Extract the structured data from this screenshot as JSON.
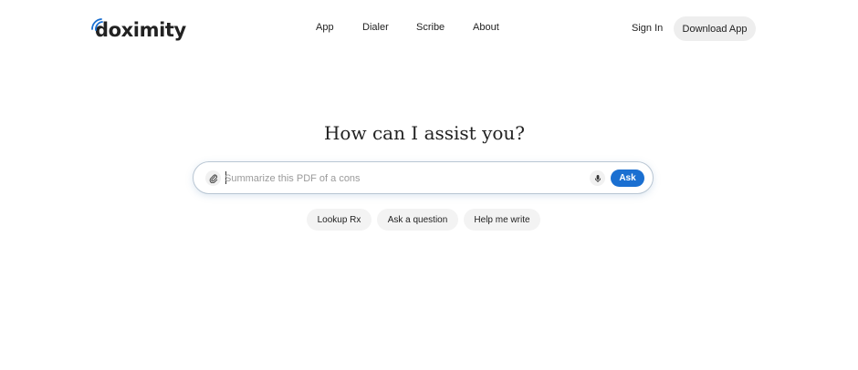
{
  "brand": {
    "name": "doximity",
    "accent_color": "#1a6fd1"
  },
  "nav": {
    "items": [
      {
        "label": "App"
      },
      {
        "label": "Dialer"
      },
      {
        "label": "Scribe"
      },
      {
        "label": "About"
      }
    ],
    "sign_in_label": "Sign In",
    "download_label": "Download App"
  },
  "hero": {
    "heading": "How can I assist you?"
  },
  "search": {
    "placeholder": "Summarize this PDF of a cons",
    "value": "",
    "attach_icon": "paperclip-icon",
    "mic_icon": "microphone-icon",
    "ask_label": "Ask"
  },
  "suggestions": [
    {
      "label": "Lookup Rx"
    },
    {
      "label": "Ask a question"
    },
    {
      "label": "Help me write"
    }
  ]
}
